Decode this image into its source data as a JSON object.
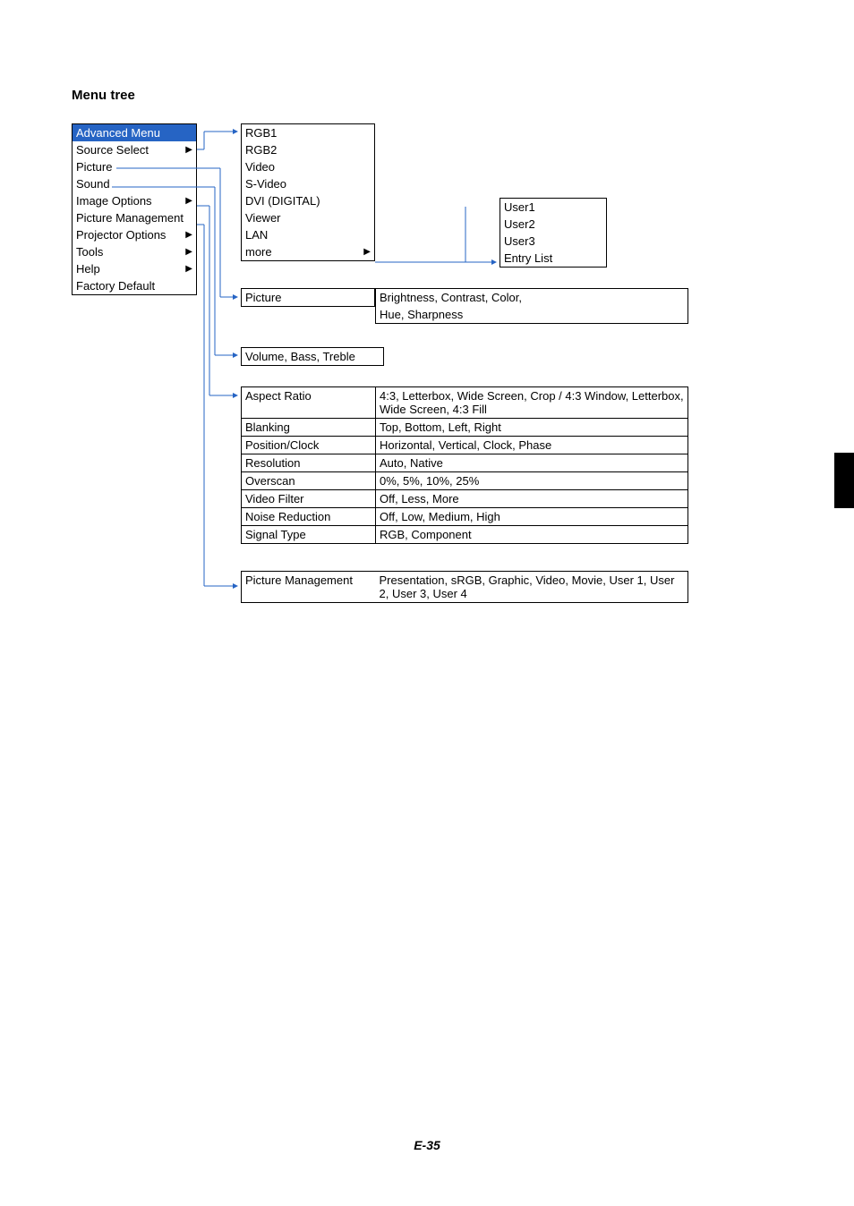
{
  "page": {
    "title": "Menu tree",
    "footer": "E-35"
  },
  "main_menu": {
    "header": "Advanced Menu",
    "items": [
      {
        "label": "Source Select",
        "arrow": true
      },
      {
        "label": "Picture",
        "arrow": false
      },
      {
        "label": "Sound",
        "arrow": false
      },
      {
        "label": "Image Options",
        "arrow": true
      },
      {
        "label": "Picture Management",
        "arrow": false
      },
      {
        "label": "Projector Options",
        "arrow": true
      },
      {
        "label": "Tools",
        "arrow": true
      },
      {
        "label": "Help",
        "arrow": true
      },
      {
        "label": "Factory Default",
        "arrow": false
      }
    ]
  },
  "source_list": {
    "items": [
      {
        "label": "RGB1"
      },
      {
        "label": "RGB2"
      },
      {
        "label": "Video"
      },
      {
        "label": "S-Video"
      },
      {
        "label": "DVI (DIGITAL)"
      },
      {
        "label": "Viewer"
      },
      {
        "label": "LAN"
      },
      {
        "label": "more",
        "arrow": true
      }
    ]
  },
  "more_list": {
    "items": [
      {
        "label": "User1"
      },
      {
        "label": "User2"
      },
      {
        "label": "User3"
      },
      {
        "label": "Entry List"
      }
    ]
  },
  "picture": {
    "label": "Picture",
    "detail_line1": "Brightness, Contrast, Color,",
    "detail_line2": "Hue, Sharpness"
  },
  "sound": {
    "label": "Volume, Bass, Treble"
  },
  "image_options": [
    {
      "name": "Aspect Ratio",
      "values": "4:3, Letterbox, Wide Screen, Crop / 4:3 Window, Letterbox, Wide Screen, 4:3 Fill"
    },
    {
      "name": "Blanking",
      "values": "Top, Bottom, Left, Right"
    },
    {
      "name": "Position/Clock",
      "values": "Horizontal, Vertical, Clock, Phase"
    },
    {
      "name": "Resolution",
      "values": "Auto, Native"
    },
    {
      "name": "Overscan",
      "values": "0%, 5%, 10%, 25%"
    },
    {
      "name": "Video Filter",
      "values": "Off, Less, More"
    },
    {
      "name": "Noise Reduction",
      "values": "Off, Low, Medium, High"
    },
    {
      "name": "Signal Type",
      "values": "RGB, Component"
    }
  ],
  "picture_management": {
    "name": "Picture Management",
    "values": "Presentation, sRGB, Graphic, Video, Movie, User 1, User 2, User 3, User 4"
  }
}
